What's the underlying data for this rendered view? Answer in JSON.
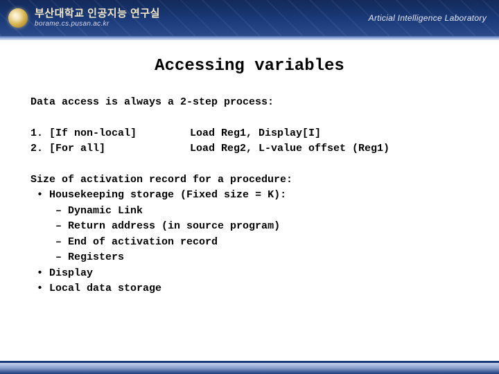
{
  "header": {
    "title": "부산대학교 인공지능 연구실",
    "subtitle": "borame.cs.pusan.ac.kr",
    "lab": "Articial Intelligence Laboratory"
  },
  "slide": {
    "title": "Accessing variables",
    "intro": "Data access is always a 2-step process:",
    "steps": [
      {
        "n": "1.",
        "cond": "[If non-local]",
        "action": "Load Reg1, Display[I]"
      },
      {
        "n": "2.",
        "cond": "[For all]",
        "action": "Load Reg2, L-value offset (Reg1)"
      }
    ],
    "section2_title": "Size of activation record for a procedure:",
    "bullets": [
      "Housekeeping storage (Fixed size = K):",
      "Display",
      "Local data storage"
    ],
    "sub_bullets": [
      "Dynamic Link",
      "Return address (in source program)",
      "End of activation record",
      "Registers"
    ]
  }
}
